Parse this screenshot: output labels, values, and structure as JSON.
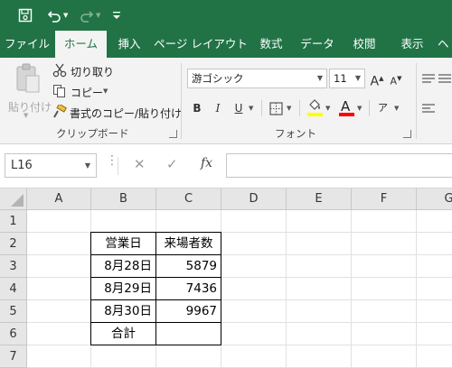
{
  "quick_access": {
    "save_icon": "save-icon",
    "undo_icon": "undo-icon",
    "redo_icon": "redo-icon",
    "customize_icon": "customize-qat-icon"
  },
  "tabs": [
    "ファイル",
    "ホーム",
    "挿入",
    "ページ レイアウト",
    "数式",
    "データ",
    "校閲",
    "表示",
    "ヘ"
  ],
  "active_tab": "ホーム",
  "ribbon": {
    "clipboard": {
      "paste_label": "貼り付け",
      "cut_label": "切り取り",
      "copy_label": "コピー",
      "format_painter_label": "書式のコピー/貼り付け",
      "group_label": "クリップボード"
    },
    "font": {
      "font_name": "游ゴシック",
      "font_size": "11",
      "grow_glyph": "A",
      "shrink_glyph": "A",
      "bold_glyph": "B",
      "italic_glyph": "I",
      "underline_glyph": "U",
      "font_color_glyph": "A",
      "phonetic_glyph": "ア",
      "group_label": "フォント",
      "fill_color": "#ffff00",
      "font_color": "#ff0000"
    }
  },
  "formula_bar": {
    "name_box": "L16",
    "cancel_glyph": "✕",
    "enter_glyph": "✓",
    "fx_label": "fx",
    "formula": ""
  },
  "grid": {
    "columns": [
      "A",
      "B",
      "C",
      "D",
      "E",
      "F",
      "G"
    ],
    "rows": [
      "1",
      "2",
      "3",
      "4",
      "5",
      "6",
      "7"
    ],
    "cells": {
      "B2": "営業日",
      "C2": "来場者数",
      "B3": "8月28日",
      "C3": "5879",
      "B4": "8月29日",
      "C4": "7436",
      "B5": "8月30日",
      "C5": "9967",
      "B6": "合計",
      "C6": ""
    }
  },
  "colors": {
    "excel_green": "#217346",
    "ribbon_bg": "#f3f3f3",
    "header_bg": "#e6e6e6"
  }
}
